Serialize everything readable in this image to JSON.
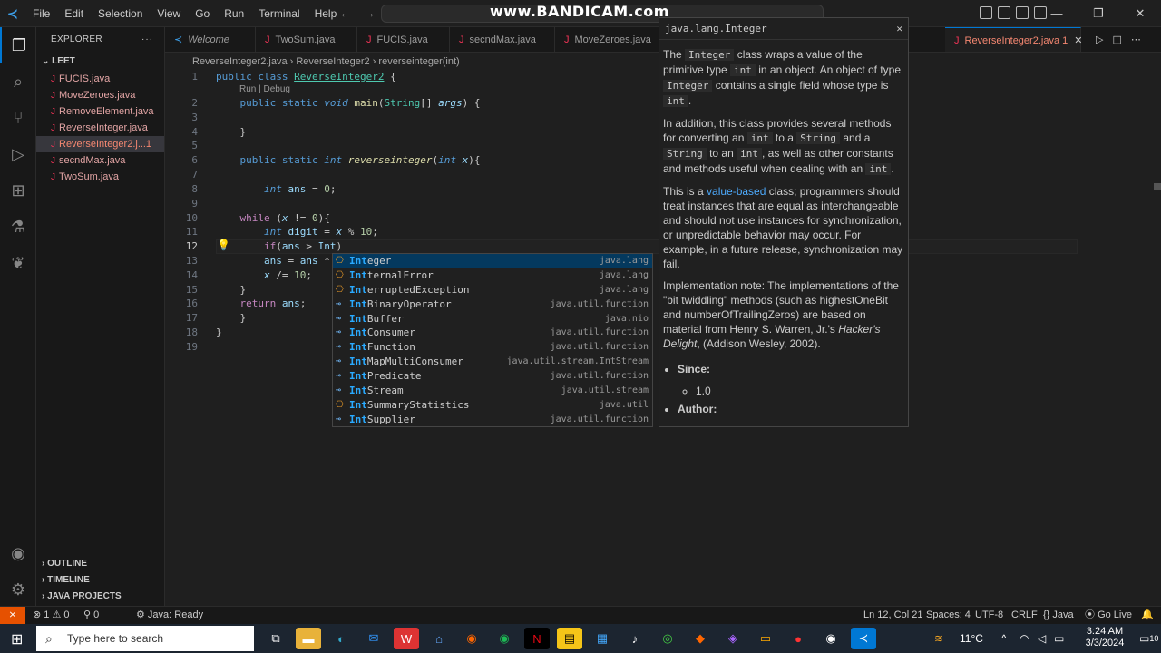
{
  "titlebar": {
    "menu": [
      "File",
      "Edit",
      "Selection",
      "View",
      "Go",
      "Run",
      "Terminal",
      "Help"
    ],
    "watermark": "www.BANDICAM.com"
  },
  "sidebar": {
    "header": "EXPLORER",
    "folder": "LEET",
    "files": [
      {
        "name": "FUCIS.java",
        "selected": false
      },
      {
        "name": "MoveZeroes.java",
        "selected": false
      },
      {
        "name": "RemoveElement.java",
        "selected": false
      },
      {
        "name": "ReverseInteger.java",
        "selected": false
      },
      {
        "name": "ReverseInteger2.j...",
        "selected": true,
        "badge": "1"
      },
      {
        "name": "secndMax.java",
        "selected": false
      },
      {
        "name": "TwoSum.java",
        "selected": false
      }
    ],
    "bottom": [
      "OUTLINE",
      "TIMELINE",
      "JAVA PROJECTS"
    ]
  },
  "tabs": [
    {
      "label": "Welcome"
    },
    {
      "label": "TwoSum.java"
    },
    {
      "label": "FUCIS.java"
    },
    {
      "label": "secndMax.java"
    },
    {
      "label": "MoveZeroes.java"
    },
    {
      "label": "ReverseInteger2.java 1",
      "active": true
    }
  ],
  "breadcrumb": "ReverseInteger2.java  ›  ReverseInteger2  ›  reverseinteger(int)",
  "codelens": "Run | Debug",
  "line_numbers": [
    "1",
    "",
    "2",
    "3",
    "4",
    "5",
    "6",
    "7",
    "8",
    "9",
    "10",
    "11",
    "12",
    "13",
    "14",
    "15",
    "16",
    "17",
    "18",
    "19"
  ],
  "suggestions": [
    {
      "bold": "Int",
      "rest": "eger",
      "pkg": "java.lang",
      "kind": "class"
    },
    {
      "bold": "In",
      "rest": "ternalError",
      "pkg": "java.lang",
      "kind": "class",
      "boldmix": "t"
    },
    {
      "bold": "Int",
      "rest": "erruptedException",
      "pkg": "java.lang",
      "kind": "class"
    },
    {
      "bold": "Int",
      "rest": "BinaryOperator",
      "pkg": "java.util.function",
      "kind": "interface"
    },
    {
      "bold": "Int",
      "rest": "Buffer",
      "pkg": "java.nio",
      "kind": "interface"
    },
    {
      "bold": "Int",
      "rest": "Consumer",
      "pkg": "java.util.function",
      "kind": "interface"
    },
    {
      "bold": "Int",
      "rest": "Function",
      "pkg": "java.util.function",
      "kind": "interface"
    },
    {
      "bold": "Int",
      "rest": "MapMultiConsumer",
      "pkg": "java.util.stream.IntStream",
      "kind": "interface"
    },
    {
      "bold": "Int",
      "rest": "Predicate",
      "pkg": "java.util.function",
      "kind": "interface"
    },
    {
      "bold": "Int",
      "rest": "Stream",
      "pkg": "java.util.stream",
      "kind": "interface"
    },
    {
      "bold": "Int",
      "rest": "SummaryStatistics",
      "pkg": "java.util",
      "kind": "class"
    },
    {
      "bold": "Int",
      "rest": "Supplier",
      "pkg": "java.util.function",
      "kind": "interface"
    }
  ],
  "hover": {
    "title": "java.lang.Integer",
    "p1_a": "The ",
    "p1_code1": "Integer",
    "p1_b": " class wraps a value of the primitive type ",
    "p1_code2": "int",
    "p1_c": " in an object. An object of type ",
    "p1_code3": "Integer",
    "p1_d": " contains a single field whose type is ",
    "p1_code4": "int",
    "p1_e": ".",
    "p2_a": "In addition, this class provides several methods for converting an ",
    "p2_code1": "int",
    "p2_b": " to a ",
    "p2_code2": "String",
    "p2_c": " and a ",
    "p2_code3": "String",
    "p2_d": " to an ",
    "p2_code4": "int",
    "p2_e": ", as well as other constants and methods useful when dealing with an ",
    "p2_code5": "int",
    "p2_f": ".",
    "p3_a": "This is a ",
    "p3_link": "value-based",
    "p3_b": " class; programmers should treat instances that are equal as interchangeable and should not use instances for synchronization, or unpredictable behavior may occur. For example, in a future release, synchronization may fail.",
    "p4_a": "Implementation note: The implementations of the \"bit twiddling\" methods (such as highestOneBit and numberOfTrailingZeros) are based on material from Henry S. Warren, Jr.'s ",
    "p4_em": "Hacker's Delight",
    "p4_b": ", (Addison Wesley, 2002).",
    "since_label": "Since:",
    "since_value": "1.0",
    "author_label": "Author:"
  },
  "status": {
    "errors": "⊗ 1 ⚠ 0",
    "ports": "⚲ 0",
    "java": "Java: Ready",
    "position": "Ln 12, Col 21",
    "spaces": "Spaces: 4",
    "encoding": "UTF-8",
    "eol": "CRLF",
    "lang": "{} Java",
    "golive": "Go Live"
  },
  "taskbar": {
    "search_placeholder": "Type here to search",
    "temp": "11°C",
    "time": "3:24 AM",
    "date": "3/3/2024",
    "notif": "10"
  }
}
